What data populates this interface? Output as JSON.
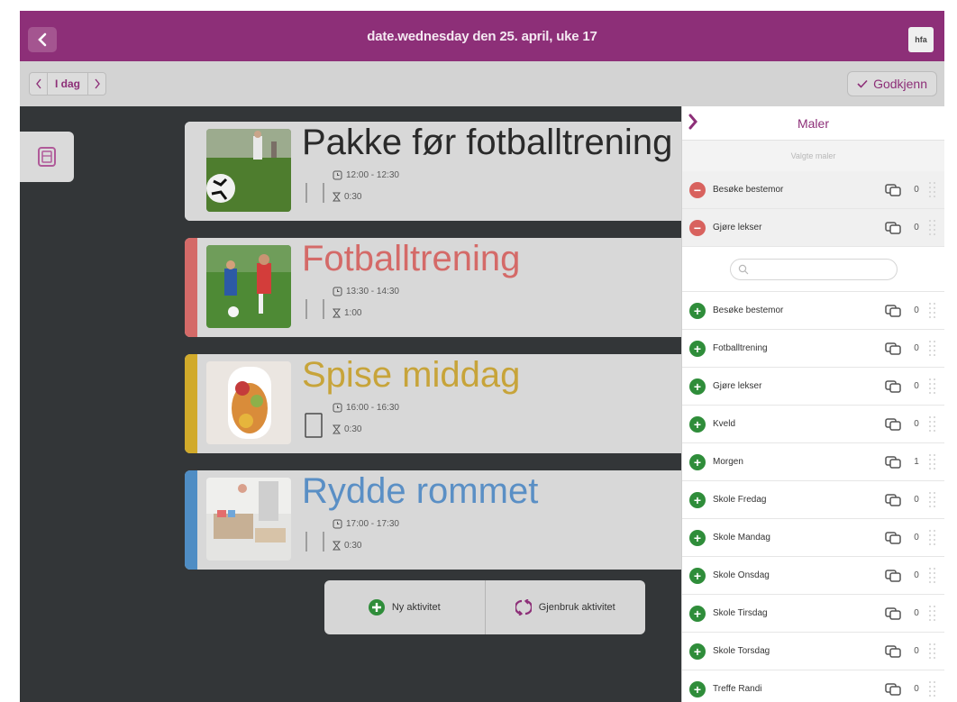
{
  "header": {
    "back_icon": "chevron-left-icon",
    "title": "date.wednesday den 25. april, uke 17",
    "user_badge": "hfa",
    "color": "#8d2f78"
  },
  "toolbar": {
    "prev_icon": "chevron-left-icon",
    "today_label": "I dag",
    "next_icon": "chevron-right-icon",
    "approve_label": "Godkjenn",
    "approve_icon": "checkmark-icon"
  },
  "activities": [
    {
      "title": "Pakke før fotballtrening",
      "time": "12:00 - 12:30",
      "duration": "0:30",
      "stripe_color": "#d8d8d8",
      "title_color": "#2a2a2a"
    },
    {
      "title": "Fotballtrening",
      "time": "13:30 - 14:30",
      "duration": "1:00",
      "stripe_color": "#d46a68",
      "title_color": "#d46a68"
    },
    {
      "title": "Spise middag",
      "time": "16:00 - 16:30",
      "duration": "0:30",
      "stripe_color": "#d1aa2a",
      "title_color": "#c7a43a"
    },
    {
      "title": "Rydde rommet",
      "time": "17:00 - 17:30",
      "duration": "0:30",
      "stripe_color": "#4f8dc4",
      "title_color": "#5a8fc5"
    }
  ],
  "actions": {
    "new_label": "Ny aktivitet",
    "reuse_label": "Gjenbruk aktivitet"
  },
  "templates": {
    "title": "Maler",
    "selected_header": "Valgte maler",
    "search_placeholder": "",
    "selected": [
      {
        "label": "Besøke bestemor",
        "count": "0"
      },
      {
        "label": "Gjøre lekser",
        "count": "0"
      }
    ],
    "available": [
      {
        "label": "Besøke bestemor",
        "count": "0"
      },
      {
        "label": "Fotballtrening",
        "count": "0"
      },
      {
        "label": "Gjøre lekser",
        "count": "0"
      },
      {
        "label": "Kveld",
        "count": "0"
      },
      {
        "label": "Morgen",
        "count": "1"
      },
      {
        "label": "Skole Fredag",
        "count": "0"
      },
      {
        "label": "Skole Mandag",
        "count": "0"
      },
      {
        "label": "Skole Onsdag",
        "count": "0"
      },
      {
        "label": "Skole Tirsdag",
        "count": "0"
      },
      {
        "label": "Skole Torsdag",
        "count": "0"
      },
      {
        "label": "Treffe Randi",
        "count": "0"
      }
    ]
  }
}
